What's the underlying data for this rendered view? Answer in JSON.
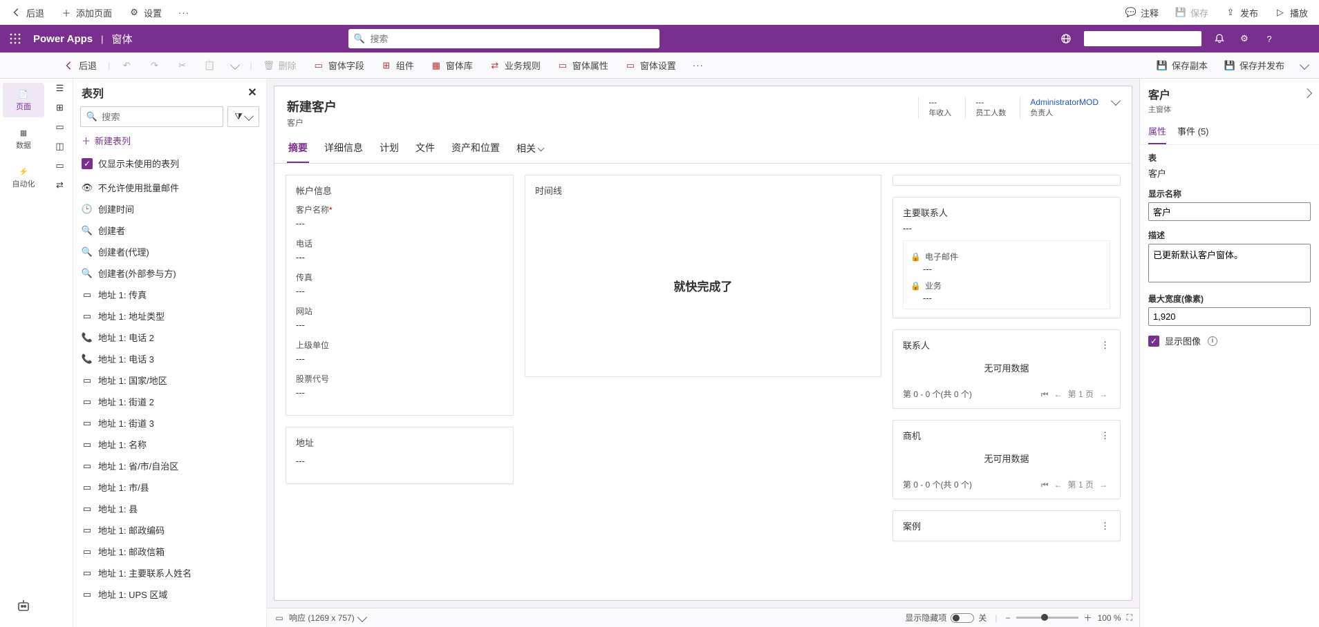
{
  "topbar": {
    "back": "后退",
    "add_page": "添加页面",
    "settings": "设置",
    "more": "···",
    "annotate": "注释",
    "save": "保存",
    "publish": "发布",
    "play": "播放"
  },
  "purple": {
    "app": "Power Apps",
    "sep": "|",
    "context": "窗体",
    "search_placeholder": "搜索"
  },
  "cmd": {
    "back": "后退",
    "delete": "删除",
    "form_fields": "窗体字段",
    "components": "组件",
    "form_lib": "窗体库",
    "biz_rules": "业务规则",
    "form_props": "窗体属性",
    "form_settings": "窗体设置",
    "more": "···",
    "save_copy": "保存副本",
    "save_publish": "保存并发布"
  },
  "leftrail": {
    "pages": "页面",
    "data": "数据",
    "automation": "自动化"
  },
  "columns": {
    "header": "表列",
    "search_placeholder": "搜索",
    "new": "新建表列",
    "only_unused": "仅显示未使用的表列",
    "items": [
      "不允许使用批量邮件",
      "创建时间",
      "创建者",
      "创建者(代理)",
      "创建者(外部参与方)",
      "地址 1: 传真",
      "地址 1: 地址类型",
      "地址 1: 电话 2",
      "地址 1: 电话 3",
      "地址 1: 国家/地区",
      "地址 1: 街道 2",
      "地址 1: 街道 3",
      "地址 1: 名称",
      "地址 1: 省/市/自治区",
      "地址 1: 市/县",
      "地址 1: 县",
      "地址 1: 邮政编码",
      "地址 1: 邮政信箱",
      "地址 1: 主要联系人姓名",
      "地址 1: UPS 区域"
    ]
  },
  "form": {
    "title": "新建客户",
    "subtitle": "客户",
    "hdr": {
      "revenue_label": "年收入",
      "revenue_val": "---",
      "emp_label": "员工人数",
      "emp_val": "---",
      "owner_label": "负责人",
      "owner_val": "AdministratorMOD"
    },
    "tabs": [
      "摘要",
      "详细信息",
      "计划",
      "文件",
      "资产和位置",
      "相关"
    ],
    "account_section": "帐户信息",
    "fields": {
      "name": {
        "label": "客户名称",
        "val": "---"
      },
      "phone": {
        "label": "电话",
        "val": "---"
      },
      "fax": {
        "label": "传真",
        "val": "---"
      },
      "web": {
        "label": "网站",
        "val": "---"
      },
      "parent": {
        "label": "上级单位",
        "val": "---"
      },
      "ticker": {
        "label": "股票代号",
        "val": "---"
      }
    },
    "address_section": "地址",
    "address_val": "---",
    "timeline_title": "时间线",
    "timeline_msg": "就快完成了",
    "contact": {
      "title": "主要联系人",
      "val": "---",
      "email": "电子邮件",
      "email_val": "---",
      "biz": "业务",
      "biz_val": "---"
    },
    "subgrids": {
      "contacts": {
        "title": "联系人",
        "nodata": "无可用数据",
        "range": "第 0 - 0 个(共 0 个)",
        "page": "第 1 页"
      },
      "opps": {
        "title": "商机",
        "nodata": "无可用数据",
        "range": "第 0 - 0 个(共 0 个)",
        "page": "第 1 页"
      },
      "cases": {
        "title": "案例"
      }
    }
  },
  "status": {
    "responsive": "响应 (1269 x 757)",
    "hidden": "显示隐藏项",
    "off": "关",
    "zoom": "100 %"
  },
  "props": {
    "title": "客户",
    "subtitle": "主窗体",
    "tab_attr": "属性",
    "tab_events": "事件 (5)",
    "table_label": "表",
    "table_val": "客户",
    "display_label": "显示名称",
    "display_val": "客户",
    "desc_label": "描述",
    "desc_val": "已更新默认客户窗体。",
    "maxw_label": "最大宽度(像素)",
    "maxw_val": "1,920",
    "showimg": "显示图像"
  }
}
